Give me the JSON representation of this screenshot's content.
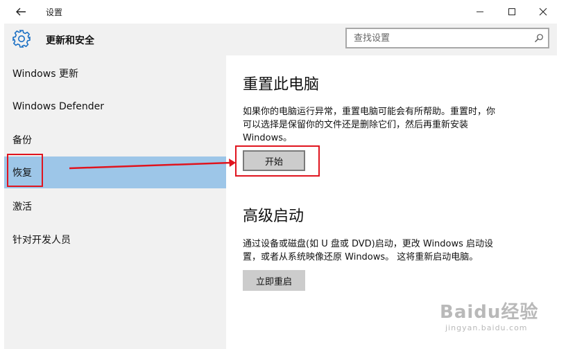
{
  "window": {
    "title": "设置"
  },
  "header": {
    "section_title": "更新和安全",
    "search_placeholder": "查找设置"
  },
  "sidebar": {
    "items": [
      {
        "label": "Windows 更新"
      },
      {
        "label": "Windows Defender"
      },
      {
        "label": "备份"
      },
      {
        "label": "恢复",
        "selected": true
      },
      {
        "label": "激活"
      },
      {
        "label": "针对开发人员"
      }
    ]
  },
  "reset": {
    "title": "重置此电脑",
    "description_line1": "如果你的电脑运行异常，重置电脑可能会有所帮助。重置时，你",
    "description_line2": "可以选择是保留你的文件还是删除它们，然后再重新安装",
    "description_line3": "Windows。",
    "button": "开始"
  },
  "advanced": {
    "title": "高级启动",
    "description_line1": "通过设备或磁盘(如 U 盘或 DVD)启动，更改 Windows 启动设",
    "description_line2": "置，或者从系统映像还原 Windows。 这将重新启动电脑。",
    "button": "立即重启"
  },
  "watermark": {
    "brand": "Baidu经验",
    "url": "jingyan.baidu.com"
  },
  "colors": {
    "selected_bg": "#9dc6e8",
    "annotation": "#e0141e",
    "accent_icon": "#1a6fc4"
  },
  "icons": [
    "back-arrow-icon",
    "minimize-icon",
    "maximize-icon",
    "close-icon",
    "gear-icon",
    "search-icon"
  ]
}
